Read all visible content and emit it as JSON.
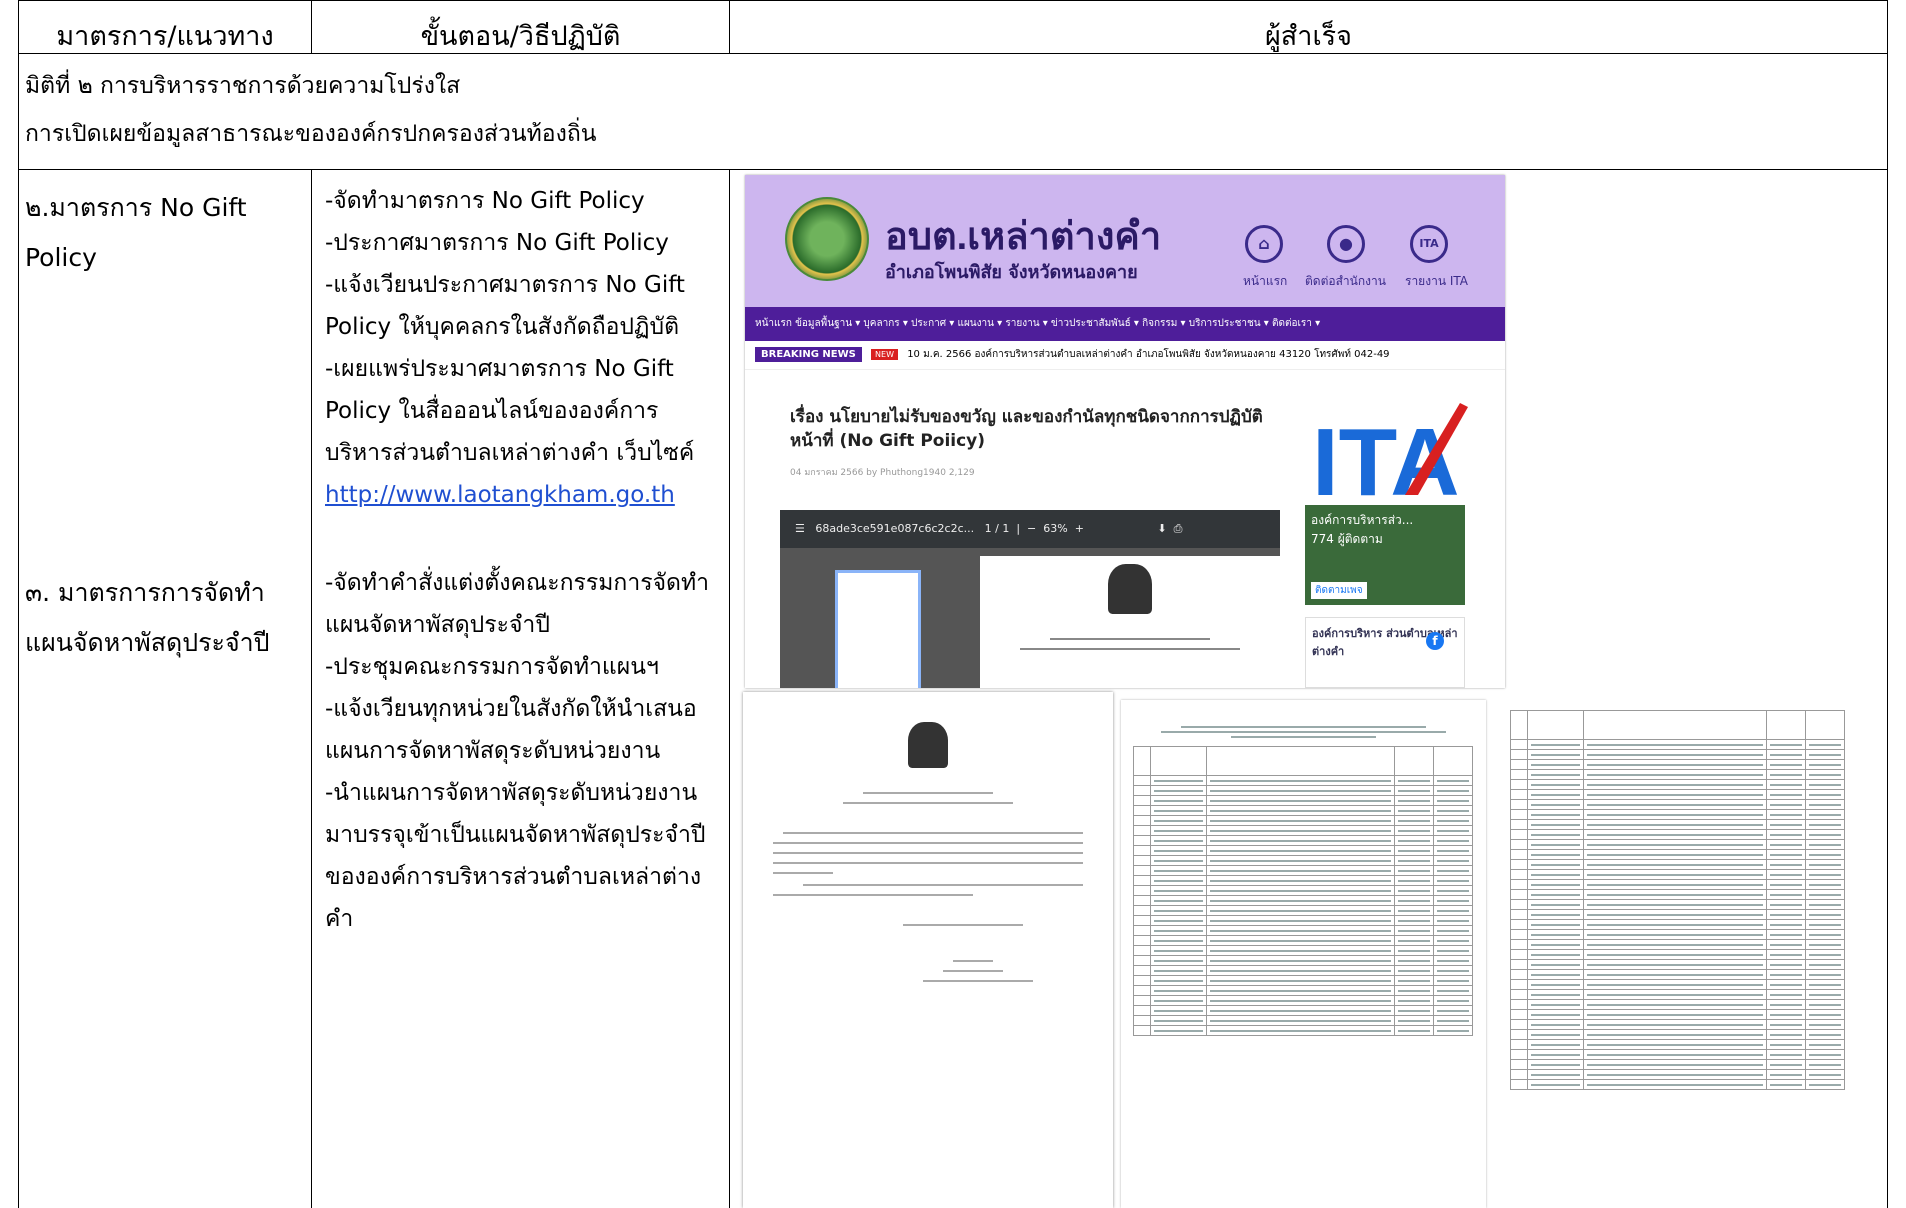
{
  "header": {
    "col1": "มาตรการ/แนวทาง",
    "col2": "ขั้นตอน/วิธีปฏิบัติ",
    "col3": "ผู้สำเร็จ"
  },
  "section": {
    "line1": "มิติที่ ๒ การบริหารราชการด้วยความโปร่งใส",
    "line2": "การเปิดเผยข้อมูลสาธารณะขององค์กรปกครองส่วนท้องถิ่น"
  },
  "measure2": {
    "name_line1": "๒.มาตรการ No Gift",
    "name_line2": "Policy",
    "steps": [
      "-จัดทำมาตรการ No Gift Policy",
      "-ประกาศมาตรการ No Gift Policy",
      "-แจ้งเวียนประกาศมาตรการ No Gift",
      "Policy ให้บุคคลกรในสังกัดถือปฏิบัติ",
      "-เผยแพร่ประมาศมาตรการ No Gift",
      "Policy ในสื่อออนไลน์ขององค์การ",
      "บริหารส่วนตำบลเหล่าต่างคำ เว็บไซค์"
    ],
    "link": "http://www.laotangkham.go.th"
  },
  "measure3": {
    "name_line1": "๓. มาตรการการจัดทำ",
    "name_line2": "แผนจัดหาพัสดุประจำปี",
    "steps": [
      "-จัดทำคำสั่งแต่งตั้งคณะกรรมการจัดทำ",
      "แผนจัดหาพัสดุประจำปี",
      "-ประชุมคณะกรรมการจัดทำแผนฯ",
      "-แจ้งเวียนทุกหน่วยในสังกัดให้นำเสนอ",
      "แผนการจัดหาพัสดุระดับหน่วยงาน",
      "-นำแผนการจัดหาพัสดุระดับหน่วยงาน",
      "มาบรรจุเข้าเป็นแผนจัดหาพัสดุประจำปี",
      "ขององค์การบริหารส่วนตำบลเหล่าต่าง",
      "คำ"
    ]
  },
  "website": {
    "title": "อบต.เหล่าต่างคำ",
    "subtitle": "อำเภอโพนพิสัย จังหวัดหนองคาย",
    "top_icons": [
      "หน้าแรก",
      "ติดต่อสำนักงาน",
      "รายงาน ITA"
    ],
    "menu": "หน้าแรก  ข้อมูลพื้นฐาน ▾  บุคลากร ▾  ประกาศ ▾  แผนงาน ▾  รายงาน ▾  ข่าวประชาสัมพันธ์ ▾  กิจกรรม ▾  บริการประชาชน ▾  ติดต่อเรา ▾",
    "breaking": "BREAKING NEWS",
    "new_tag": "NEW",
    "ticker": "10 ม.ค. 2566 องค์การบริหารส่วนตำบลเหล่าต่างคำ อำเภอโพนพิสัย จังหวัดหนองคาย 43120 โทรศัพท์ 042-49",
    "article_title": "เรื่อง นโยบายไม่รับของขวัญ และของกำนัลทุกชนิดจากการปฏิบัติหน้าที่ (No Gift Poiicy)",
    "article_meta": "04 มกราคม 2566  by Phuthong1940  2,129",
    "pdf_file": "68ade3ce591e087c6c2c2c...",
    "pdf_page": "1 / 1",
    "pdf_zoom": "63%",
    "ita_logo": "ITA",
    "fb_page": "องค์การบริหารส่ว...",
    "fb_likes": "774 ผู้ติดตาม",
    "fb_follow": "ติดตามเพจ",
    "fb_name": "องค์การบริหาร ส่วนตำบลเหล่า ต่างคำ"
  },
  "colors": {
    "banner": "#cdb6ef",
    "menu": "#4e1e9a",
    "link": "#1f4fd1",
    "ita_blue": "#1a6ad8",
    "ita_red": "#d82020"
  }
}
